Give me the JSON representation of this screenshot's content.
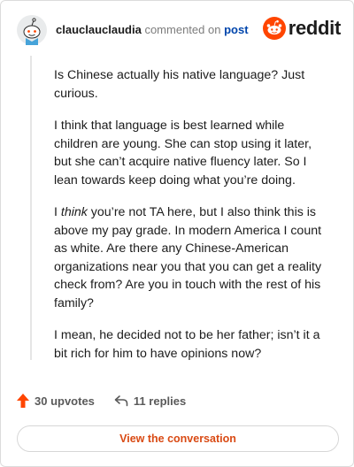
{
  "header": {
    "username": "clauclauclaudia",
    "action_text": "commented on",
    "post_link": "post",
    "logo_text": "reddit"
  },
  "comment": {
    "p1": "Is Chinese actually his native language? Just curious.",
    "p2": "I think that language is best learned while children are young. She can stop using it later, but she can’t acquire native fluency later. So I lean towards keep doing what you’re doing.",
    "p3_before_em": "I ",
    "p3_em": "think",
    "p3_after_em": " you’re not TA here, but I also think this is above my pay grade. In modern America I count as white. Are there any Chinese-American organizations near you that you can get a reality check from? Are you in touch with the rest of his family?",
    "p4": "I mean, he decided not to be her father; isn’t it a bit rich for him to have opinions now?"
  },
  "footer": {
    "upvotes": "30 upvotes",
    "replies": "11 replies",
    "view_button": "View the conversation"
  },
  "colors": {
    "brand_orange": "#ff4500",
    "link_blue": "#0045ac",
    "button_text": "#d94a14"
  }
}
